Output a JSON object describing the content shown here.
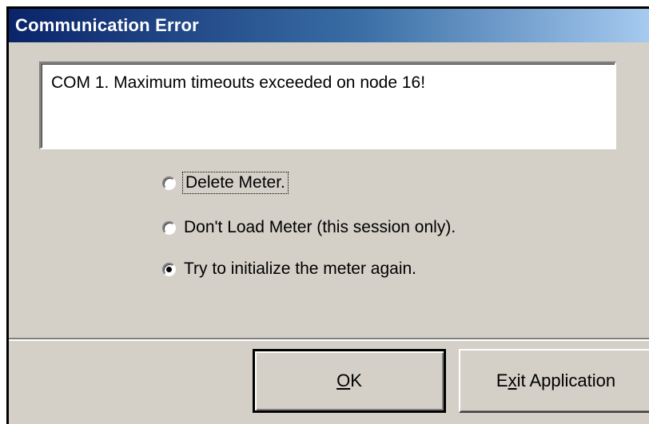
{
  "window": {
    "title": "Communication Error"
  },
  "message": {
    "text": "COM 1. Maximum timeouts exceeded on node 16!"
  },
  "options": [
    {
      "label": "Delete Meter.",
      "checked": false,
      "focused": true
    },
    {
      "label": "Don't Load Meter (this session only).",
      "checked": false,
      "focused": false
    },
    {
      "label": "Try to initialize the meter again.",
      "checked": true,
      "focused": false
    }
  ],
  "buttons": {
    "ok": {
      "mnemonic": "O",
      "rest": "K"
    },
    "exit": {
      "pre": "E",
      "mnemonic": "x",
      "rest": "it Application"
    }
  },
  "colors": {
    "titlebar_start": "#0a246a",
    "titlebar_end": "#a6caf0",
    "dialog_face": "#d4d0c8"
  }
}
